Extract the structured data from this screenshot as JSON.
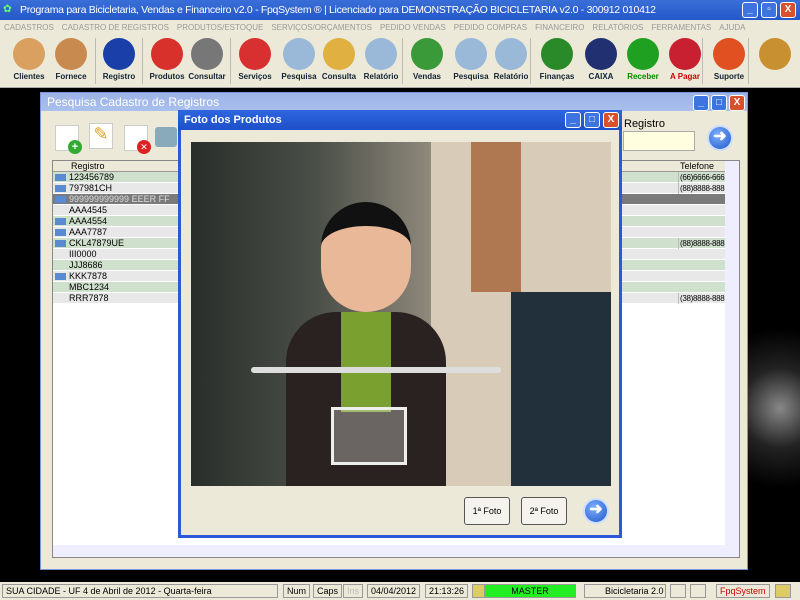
{
  "app": {
    "title": "Programa para Bicicletaria, Vendas e Financeiro v2.0 - FpqSystem ® | Licenciado para  DEMONSTRAÇÃO BICICLETARIA v2.0 - 300912 010412"
  },
  "menu": [
    "CADASTROS",
    "CADASTRO DE REGISTROS",
    "PRODUTOS/ESTOQUE",
    "SERVIÇOS/ORÇAMENTOS",
    "PEDIDO VENDAS",
    "PEDIDO COMPRAS",
    "FINANCEIRO",
    "RELATÓRIOS",
    "FERRAMENTAS",
    "AJUDA"
  ],
  "toolbar": [
    {
      "label": "Clientes",
      "color": "#d9a060"
    },
    {
      "label": "Fornece",
      "color": "#c98a50"
    },
    {
      "label": "Registro",
      "color": "#1a3fa8"
    },
    {
      "label": "Produtos",
      "color": "#d8302a"
    },
    {
      "label": "Consultar",
      "color": "#777777"
    },
    {
      "label": "Serviços",
      "color": "#d83030"
    },
    {
      "label": "Pesquisa",
      "color": "#9ab8d8"
    },
    {
      "label": "Consulta",
      "color": "#e0b040"
    },
    {
      "label": "Relatório",
      "color": "#9ab8d8"
    },
    {
      "label": "Vendas",
      "color": "#3a9a3a"
    },
    {
      "label": "Pesquisa",
      "color": "#9ab8d8"
    },
    {
      "label": "Relatório",
      "color": "#9ab8d8"
    },
    {
      "label": "Finanças",
      "color": "#2a8a2a"
    },
    {
      "label": "CAIXA",
      "color": "#203070"
    },
    {
      "label": "Receber",
      "color": "#20a020"
    },
    {
      "label": "A Pagar",
      "color": "#c82030"
    },
    {
      "label": "Suporte",
      "color": "#e05020"
    },
    {
      "label": "",
      "color": "#c89030"
    }
  ],
  "search_window": {
    "title": "Pesquisa Cadastro de Registros",
    "search_label": "Registro",
    "search_value": "",
    "columns": [
      "Registro",
      "Telefone"
    ],
    "rows": [
      {
        "registro": "123456789",
        "telefone": "(66)6666-666",
        "photo": true,
        "style": "g"
      },
      {
        "registro": "797981CH",
        "telefone": "(88)8888-888",
        "photo": true,
        "style": "w"
      },
      {
        "registro": "999999999999 EEER FF",
        "telefone": "",
        "photo": true,
        "style": "sel"
      },
      {
        "registro": "AAA4545",
        "telefone": "",
        "photo": false,
        "style": "w"
      },
      {
        "registro": "AAA4554",
        "telefone": "",
        "photo": true,
        "style": "g"
      },
      {
        "registro": "AAA7787",
        "telefone": "",
        "photo": true,
        "style": "w"
      },
      {
        "registro": "CKL47879UE",
        "telefone": "(88)8888-888",
        "photo": true,
        "style": "g"
      },
      {
        "registro": "III0000",
        "telefone": "",
        "photo": false,
        "style": "w"
      },
      {
        "registro": "JJJ8686",
        "telefone": "",
        "photo": false,
        "style": "g"
      },
      {
        "registro": "KKK7878",
        "telefone": "",
        "photo": true,
        "style": "w"
      },
      {
        "registro": "MBC1234",
        "telefone": "",
        "photo": false,
        "style": "g"
      },
      {
        "registro": "RRR7878",
        "telefone": "(38)8888-888",
        "photo": false,
        "style": "w"
      }
    ]
  },
  "photo_dialog": {
    "title": "Foto dos Produtos",
    "btn1": "1ª Foto",
    "btn2": "2ª Foto"
  },
  "status": {
    "location": "SUA CIDADE - UF  4 de Abril de 2012 - Quarta-feira",
    "num": "Num",
    "caps": "Caps",
    "ins": "Ins",
    "date": "04/04/2012",
    "time": "21:13:26",
    "user": "MASTER",
    "system": "Bicicletaria 2.0",
    "brand": "FpqSystem"
  }
}
